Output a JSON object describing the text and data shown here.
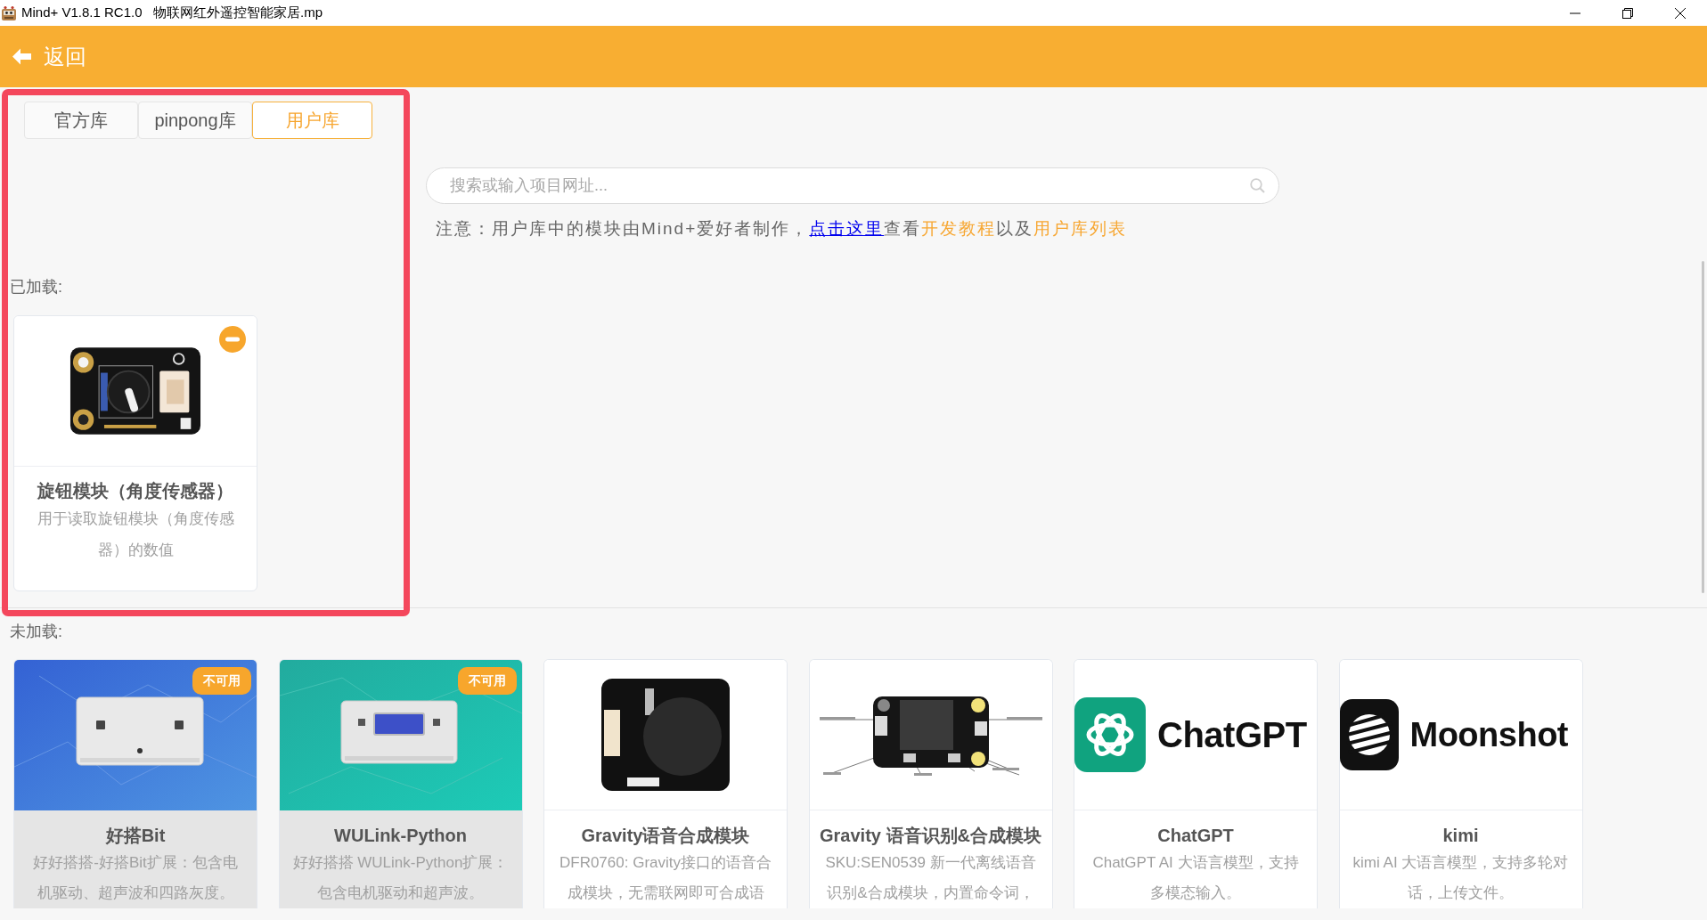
{
  "window": {
    "title": "Mind+ V1.8.1 RC1.0   物联网红外遥控智能家居.mp"
  },
  "header": {
    "back_label": "返回"
  },
  "tabs": [
    {
      "label": "官方库",
      "selected": false
    },
    {
      "label": "pinpong库",
      "selected": false
    },
    {
      "label": "用户库",
      "selected": true
    }
  ],
  "search": {
    "placeholder": "搜索或输入项目网址..."
  },
  "notice": [
    {
      "kind": "text",
      "text": "注意：用户库中的模块由Mind+爱好者制作，"
    },
    {
      "kind": "link",
      "text": "点击这里"
    },
    {
      "kind": "text",
      "text": "查看"
    },
    {
      "kind": "accent",
      "text": "开发教程"
    },
    {
      "kind": "text",
      "text": "以及"
    },
    {
      "kind": "accent",
      "text": "用户库列表"
    }
  ],
  "loaded": {
    "label": "已加载:",
    "modules": [
      {
        "kind": "knob",
        "title": "旋钮模块（角度传感器）",
        "description": "用于读取旋钮模块（角度传感器）的数值",
        "disabled": false
      }
    ]
  },
  "unloaded": {
    "label": "未加载:",
    "modules": [
      {
        "kind": "bluebox",
        "title": "好搭Bit",
        "description": "好好搭搭-好搭Bit扩展：包含电机驱动、超声波和四路灰度。",
        "disabled": true,
        "badge": "不可用"
      },
      {
        "kind": "tealbox",
        "title": "WULink-Python",
        "description": "好好搭搭 WULink-Python扩展：包含电机驱动和超声波。",
        "disabled": true,
        "badge": "不可用"
      },
      {
        "kind": "speaker",
        "title": "Gravity语音合成模块",
        "description": "DFR0760: Gravity接口的语音合成模块，无需联网即可合成语",
        "disabled": false
      },
      {
        "kind": "voice",
        "title": "Gravity 语音识别&合成模块",
        "description": "SKU:SEN0539 新一代离线语音识别&合成模块，内置命令词，",
        "disabled": false
      },
      {
        "kind": "knot",
        "title": "ChatGPT",
        "description": "ChatGPT AI 大语言模型，支持多模态输入。",
        "disabled": false,
        "logo_text": "ChatGPT"
      },
      {
        "kind": "stripes",
        "title": "kimi",
        "description": "kimi AI 大语言模型，支持多轮对话，上传文件。",
        "disabled": false,
        "logo_text": "Moonshot"
      }
    ]
  }
}
